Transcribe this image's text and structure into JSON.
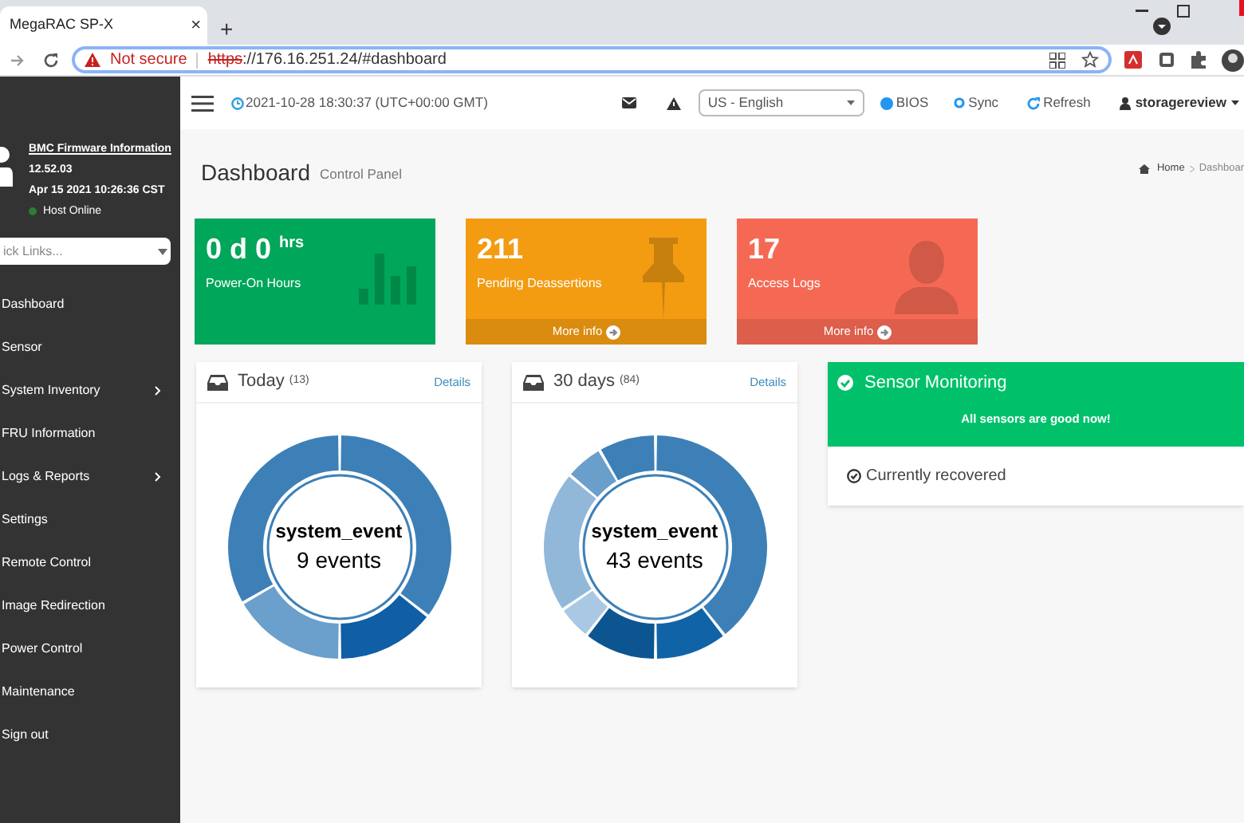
{
  "browser": {
    "tab": {
      "title": "MegaRAC SP-X",
      "close": "×"
    },
    "new_tab": "+",
    "security": "Not secure",
    "url_scheme": "https",
    "url_rest": "://176.16.251.24/#dashboard"
  },
  "sidebar": {
    "firmware_link": "BMC Firmware Information",
    "version": "12.52.03",
    "build_date": "Apr 15 2021 10:26:36 CST",
    "host_status": {
      "label": "Host Online",
      "color": "#2e7d32"
    },
    "quick_links": {
      "placeholder": "ick Links..."
    },
    "items": [
      {
        "label": "Dashboard",
        "has_submenu": false
      },
      {
        "label": "Sensor",
        "has_submenu": false
      },
      {
        "label": "System Inventory",
        "has_submenu": true
      },
      {
        "label": "FRU Information",
        "has_submenu": false
      },
      {
        "label": "Logs & Reports",
        "has_submenu": true
      },
      {
        "label": "Settings",
        "has_submenu": false
      },
      {
        "label": "Remote Control",
        "has_submenu": false
      },
      {
        "label": "Image Redirection",
        "has_submenu": false
      },
      {
        "label": "Power Control",
        "has_submenu": false
      },
      {
        "label": "Maintenance",
        "has_submenu": false
      },
      {
        "label": "Sign out",
        "has_submenu": false
      }
    ]
  },
  "header": {
    "datetime": "2021-10-28 18:30:37 (UTC+00:00 GMT)",
    "language": "US - English",
    "bios": "BIOS",
    "sync": "Sync",
    "refresh": "Refresh",
    "user": "storagereview"
  },
  "page": {
    "title": "Dashboard",
    "subtitle": "Control Panel",
    "breadcrumb": [
      "Home",
      "Dashboar"
    ]
  },
  "stat_cards": [
    {
      "kind": "uptime",
      "value": "0 d 0",
      "unit": "hrs",
      "label": "Power-On Hours",
      "color": "#00a65a"
    },
    {
      "kind": "pin",
      "value": "211",
      "label": "Pending Deassertions",
      "footer": "More info",
      "color": "#f39c12"
    },
    {
      "kind": "person",
      "value": "17",
      "label": "Access Logs",
      "footer": "More info",
      "color": "#f56954"
    }
  ],
  "event_panels": [
    {
      "title": "Today",
      "count": "(13)",
      "link": "Details",
      "center_title": "system_event",
      "center_count": "9 events"
    },
    {
      "title": "30 days",
      "count": "(84)",
      "link": "Details",
      "center_title": "system_event",
      "center_count": "43 events"
    }
  ],
  "sensor_monitoring": {
    "title": "Sensor Monitoring",
    "message": "All sensors are good now!",
    "status": "Currently recovered"
  }
}
